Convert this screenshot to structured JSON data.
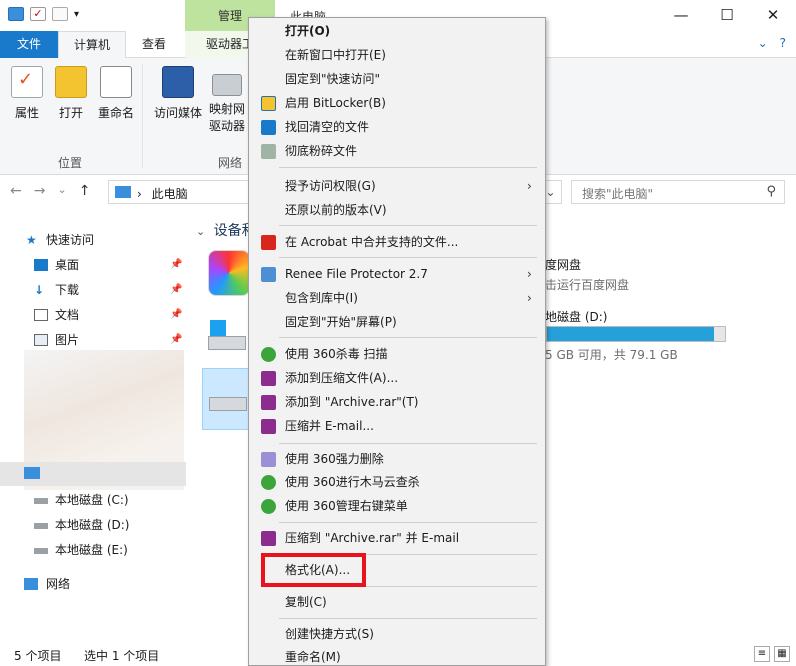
{
  "window": {
    "title": "此电脑",
    "manage_tab": "管理",
    "controls": {
      "minimize": "—",
      "maximize": "☐",
      "close": "✕"
    }
  },
  "ribbon_tabs": {
    "file": "文件",
    "computer": "计算机",
    "view": "查看",
    "drive_tools": "驱动器工",
    "chevron": "⌄",
    "help": "?"
  },
  "ribbon": {
    "properties": "属性",
    "open": "打开",
    "rename": "重命名",
    "access_media": "访问媒体",
    "map_drive_1": "映射网",
    "map_drive_2": "驱动器",
    "group_location": "位置",
    "group_network": "网络"
  },
  "address": {
    "back": "←",
    "forward": "→",
    "recent": "⌄",
    "up": "↑",
    "sep": "›",
    "crumb": "此电脑",
    "dropdown": "⌄",
    "search_placeholder": "搜索\"此电脑\"",
    "search_icon": "⚲"
  },
  "nav_pane": {
    "quick_access": "快速访问",
    "desktop": "桌面",
    "downloads": "下载",
    "documents": "文档",
    "pictures": "图片",
    "drive_c": "本地磁盘 (C:)",
    "drive_d": "本地磁盘 (D:)",
    "drive_e": "本地磁盘 (E:)",
    "network": "网络",
    "pin": "📌"
  },
  "content": {
    "section_header": "设备和",
    "baidu_1": "度网盘",
    "baidu_2": "击运行百度网盘",
    "drive_d_label": "地磁盘 (D:)",
    "drive_d_free": "5 GB 可用，共 79.1 GB",
    "drive_d_used_fraction": 0.94
  },
  "status": {
    "item_count": "5 个项目",
    "selected": "选中 1 个项目"
  },
  "menu": {
    "open": "打开(O)",
    "open_new_window": "在新窗口中打开(E)",
    "pin_quick": "固定到\"快速访问\"",
    "bitlocker": "启用 BitLocker(B)",
    "recover": "找回清空的文件",
    "shred": "彻底粉碎文件",
    "grant_access": "授予访问权限(G)",
    "restore_prev": "还原以前的版本(V)",
    "acrobat": "在 Acrobat 中合并支持的文件...",
    "renee": "Renee File Protector 2.7",
    "include_library": "包含到库中(I)",
    "pin_start": "固定到\"开始\"屏幕(P)",
    "scan360": "使用 360杀毒 扫描",
    "add_archive": "添加到压缩文件(A)...",
    "add_archive_rar": "添加到 \"Archive.rar\"(T)",
    "compress_email": "压缩并 E-mail...",
    "force_delete": "使用 360强力删除",
    "trojan_scan": "使用 360进行木马云查杀",
    "manage_menu": "使用 360管理右键菜单",
    "compress_rar_email": "压缩到 \"Archive.rar\" 并 E-mail",
    "format": "格式化(A)...",
    "copy": "复制(C)",
    "create_shortcut": "创建快捷方式(S)",
    "rename": "重命名(M)",
    "submenu_arrow": "›"
  },
  "colors": {
    "accent_blue": "#1979ca",
    "manage_green": "#bde39f",
    "highlight_red": "#e8131e",
    "capacity_fill": "#26a0da"
  }
}
